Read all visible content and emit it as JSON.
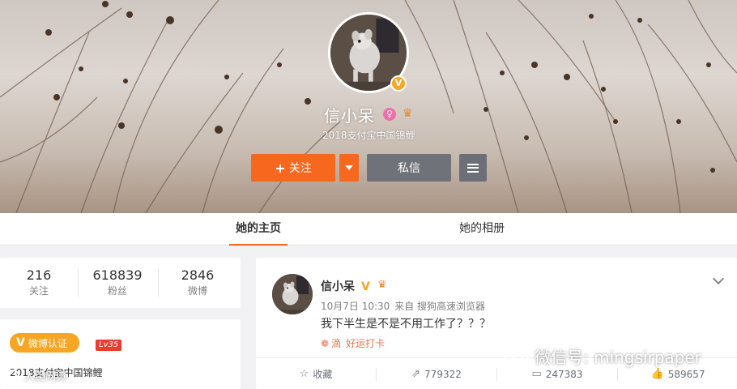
{
  "profile": {
    "name": "信小呆",
    "description": "2018支付宝中国锦鲤",
    "verified_badge": "V",
    "gender_icon": "female-icon",
    "crown_icon": "crown-icon"
  },
  "actions": {
    "follow_label": "关注",
    "follow_plus": "+",
    "message_label": "私信",
    "more_icon": "menu-icon"
  },
  "tabs": [
    {
      "label": "她的主页",
      "active": true
    },
    {
      "label": "她的相册",
      "active": false
    }
  ],
  "stats": [
    {
      "value": "216",
      "label": "关注"
    },
    {
      "value": "618839",
      "label": "粉丝"
    },
    {
      "value": "2846",
      "label": "微博"
    }
  ],
  "info": {
    "verify_label": "微博认证",
    "verify_v": "V",
    "level": "Lv35",
    "description": "2018支付宝中国锦鲤"
  },
  "post": {
    "author": "信小呆",
    "author_v": "V",
    "time": "10月7日 10:30",
    "source_prefix": "来自",
    "source": "搜狗高速浏览器",
    "text": "我下半生是不是不用工作了？？？",
    "tag_prefix": "滴",
    "tag_label": "好运打卡",
    "actions": [
      {
        "icon": "star-icon",
        "label": "收藏"
      },
      {
        "icon": "repost-icon",
        "label": "779322"
      },
      {
        "icon": "comment-icon",
        "label": "247383"
      },
      {
        "icon": "like-icon",
        "label": "589657"
      }
    ]
  },
  "watermarks": {
    "wechat": "微信号: mingsirpaper",
    "people": "人民网舆"
  },
  "colors": {
    "accent_orange": "#f7671d",
    "verify_gold": "#f6a623",
    "level_red": "#e93d2e",
    "tag_orange": "#eb7350"
  }
}
